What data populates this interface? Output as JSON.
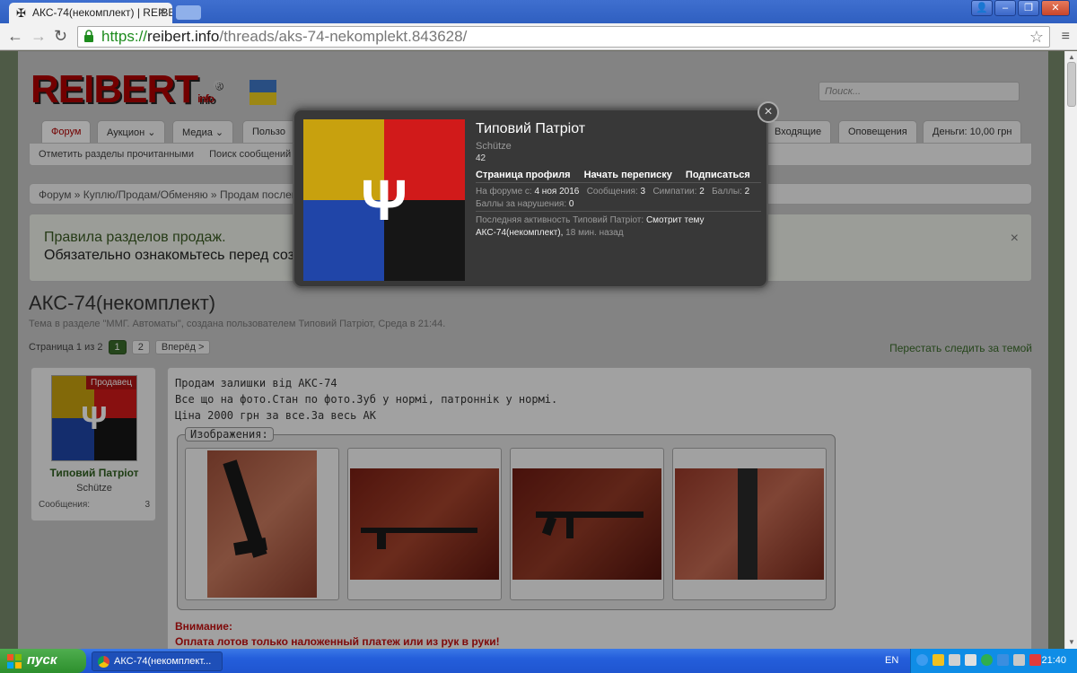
{
  "browser": {
    "tab_title": "АКС-74(некомплект) | REIBERT",
    "url_scheme": "https://",
    "url_host": "reibert.info",
    "url_path": "/threads/aks-74-nekomplekt.843628/"
  },
  "site": {
    "logo_text": "REIBERT",
    "logo_suffix": "info",
    "logo_reg": "®",
    "search_placeholder": "Поиск...",
    "nav_tabs": [
      "Форум",
      "Аукцион",
      "Медиа",
      "Пользо"
    ],
    "nav_right": [
      "Входящие",
      "Оповещения",
      "Деньги: 10,00 грн"
    ],
    "subnav": [
      "Отметить разделы прочитанными",
      "Поиск сообщений",
      "О"
    ],
    "breadcrumb": [
      "Форум",
      "Куплю/Продам/Обменяю",
      "Продам послев"
    ]
  },
  "notice": {
    "line1": "Правила разделов продаж.",
    "line2": "Обязательно ознакомьтесь перед соз",
    "close": "×"
  },
  "thread": {
    "title": "АКС-74(некомплект)",
    "description": "Тема в разделе \"ММГ. Автоматы\", создана пользователем Типовий Патріот, Среда в 21:44.",
    "page_label": "Страница 1 из 2",
    "pages": [
      "1",
      "2"
    ],
    "next_label": "Вперёд >",
    "unwatch": "Перестать следить за темой"
  },
  "post": {
    "seller_badge": "Продавец",
    "username": "Типовий Патріот",
    "rank": "Schütze",
    "messages_label": "Сообщения:",
    "messages_value": "3",
    "text_lines": [
      "Продам залишки від АКС-74",
      "Все що на фото.Стан по фото.Зуб у нормі, патроннік у нормі.",
      "Ціна 2000 грн за все.За весь АК"
    ],
    "attachments_label": "Изображения:",
    "warning_title": "Внимание:",
    "warning_text": "Оплата лотов только наложенный платеж или из рук в руки!"
  },
  "popup": {
    "name": "Типовий Патріот",
    "rank": "Schütze",
    "number": "42",
    "links": [
      "Страница профиля",
      "Начать переписку",
      "Подписаться"
    ],
    "joined_label": "На форуме с:",
    "joined_value": "4 ноя 2016",
    "messages_label": "Сообщения:",
    "messages_value": "3",
    "likes_label": "Симпатии:",
    "likes_value": "2",
    "points_label": "Баллы:",
    "points_value": "2",
    "violations_label": "Баллы за нарушения:",
    "violations_value": "0",
    "activity_label": "Последняя активность Типовий Патріот:",
    "activity_action": "Смотрит тему",
    "activity_thread": "АКС-74(некомплект),",
    "activity_time": "18 мин. назад",
    "close": "×"
  },
  "taskbar": {
    "start_label": "пуск",
    "task_title": "АКС-74(некомплект...",
    "language": "EN",
    "clock": "21:40"
  },
  "colors": {
    "brand_red": "#b00000",
    "link_green": "#3a6b2a",
    "flag_yellow": "#c8a10e",
    "flag_red": "#d11a1a",
    "flag_blue": "#2045a8",
    "flag_black": "#161616"
  }
}
